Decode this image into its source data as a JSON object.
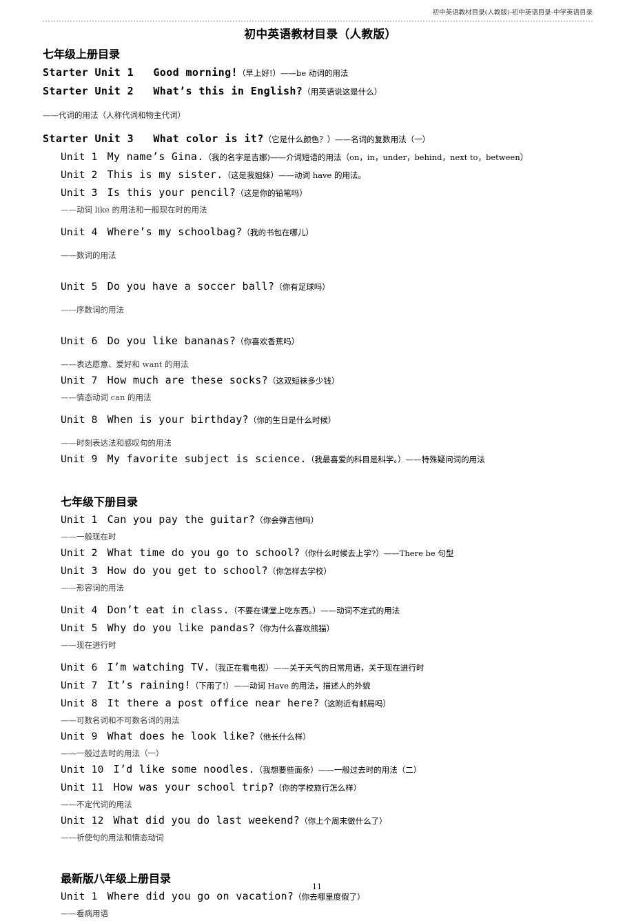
{
  "header": {
    "running_head": "初中英语教材目录(人教版)-初中英语目录-中学英语目录"
  },
  "title": "初中英语教材目录（人教版）",
  "footer": {
    "page_number": "11"
  },
  "sections": [
    {
      "heading": "七年级上册目录",
      "starters": [
        {
          "label": "Starter Unit 1",
          "en": "Good morning!",
          "gloss": "（早上好!）——be 动词的用法"
        },
        {
          "label": "Starter Unit 2",
          "en": "What’s this in English?",
          "gloss": "（用英语说这是什么）"
        },
        {
          "note": "——代词的用法（人称代词和物主代词）"
        },
        {
          "label": "Starter Unit 3",
          "en": "What color is it?",
          "gloss": "（它是什么颜色？）——名词的复数用法（一）"
        }
      ],
      "units": [
        {
          "label": "Unit 1",
          "en": "My name’s Gina.",
          "gloss": "（我的名字是吉娜)——介词短语的用法（on，in，under，behind，next to，between）"
        },
        {
          "label": "Unit 2",
          "en": "This is my sister.",
          "gloss": "（这是我姐妹）——动词 have 的用法。"
        },
        {
          "label": "Unit 3",
          "en": "Is this your pencil?",
          "gloss": "（这是你的铅笔吗）",
          "sub": "——动词 like 的用法和一般现在时的用法"
        },
        {
          "label": "Unit 4",
          "en": "Where’s my schoolbag?",
          "gloss": "（我的书包在哪儿）",
          "sub": "——数词的用法"
        },
        {
          "label": "Unit 5",
          "en": "Do you have a soccer ball?",
          "gloss": "（你有足球吗）",
          "sub": "——序数词的用法"
        },
        {
          "label": "Unit 6",
          "en": "Do you like bananas?",
          "gloss": "（你喜欢香蕉吗）",
          "sub": "——表达愿意、爱好和 want 的用法"
        },
        {
          "label": "Unit 7",
          "en": "How much are these socks?",
          "gloss": "（这双短袜多少钱）",
          "sub": "——情态动词 can 的用法"
        },
        {
          "label": "Unit 8",
          "en": "When is your birthday?",
          "gloss": "（你的生日是什么时候）",
          "sub": "——时刻表达法和感叹句的用法"
        },
        {
          "label": "Unit 9",
          "en": "My favorite subject is science.",
          "gloss": "（我最喜爱的科目是科学。）——特殊疑问词的用法"
        }
      ]
    },
    {
      "heading": "七年级下册目录",
      "starters": [],
      "units": [
        {
          "label": "Unit 1",
          "en": "Can you pay the guitar?",
          "gloss": "（你会弹吉他吗）",
          "sub": "——一般现在时"
        },
        {
          "label": "Unit 2",
          "en": "What time do you go to school?",
          "gloss": "（你什么时候去上学?）——There be 句型"
        },
        {
          "label": "Unit 3",
          "en": "How do you get to school?",
          "gloss": "（你怎样去学校）",
          "sub": "——形容词的用法"
        },
        {
          "label": "Unit 4",
          "en": "Don’t eat in class.",
          "gloss": "（不要在课堂上吃东西。）——动词不定式的用法"
        },
        {
          "label": "Unit 5",
          "en": "Why do you like pandas?",
          "gloss": "（你为什么喜欢熊猫）",
          "sub": "——现在进行时"
        },
        {
          "label": "Unit 6",
          "en": "I’m watching TV.",
          "gloss": "（我正在看电视）——关于天气的日常用语，关于现在进行时"
        },
        {
          "label": "Unit 7",
          "en": "It’s raining!",
          "gloss": "（下雨了!）——动词 Have 的用法，描述人的外貌"
        },
        {
          "label": "Unit 8",
          "en": "It there a post office near here?",
          "gloss": "（这附近有邮局吗）",
          "sub": "——可数名词和不可数名词的用法"
        },
        {
          "label": "Unit 9",
          "en": "What does he look like?",
          "gloss": "（他长什么样）",
          "sub": "——一般过去时的用法（一）"
        },
        {
          "label": "Unit 10",
          "en": "I’d like some noodles.",
          "gloss": "（我想要些面条）——一般过去时的用法（二）"
        },
        {
          "label": "Unit 11",
          "en": "How was your school trip?",
          "gloss": "（你的学校旅行怎么样）",
          "sub": "——不定代词的用法"
        },
        {
          "label": "Unit 12",
          "en": "What did you do last weekend?",
          "gloss": "（你上个周末做什么了）",
          "sub": "——祈使句的用法和情态动词"
        }
      ]
    },
    {
      "heading": "最新版八年级上册目录",
      "starters": [],
      "units": [
        {
          "label": "Unit 1",
          "en": "Where did you go on vacation?",
          "gloss": "（你去哪里度假了）",
          "sub": "——看病用语"
        }
      ]
    }
  ]
}
